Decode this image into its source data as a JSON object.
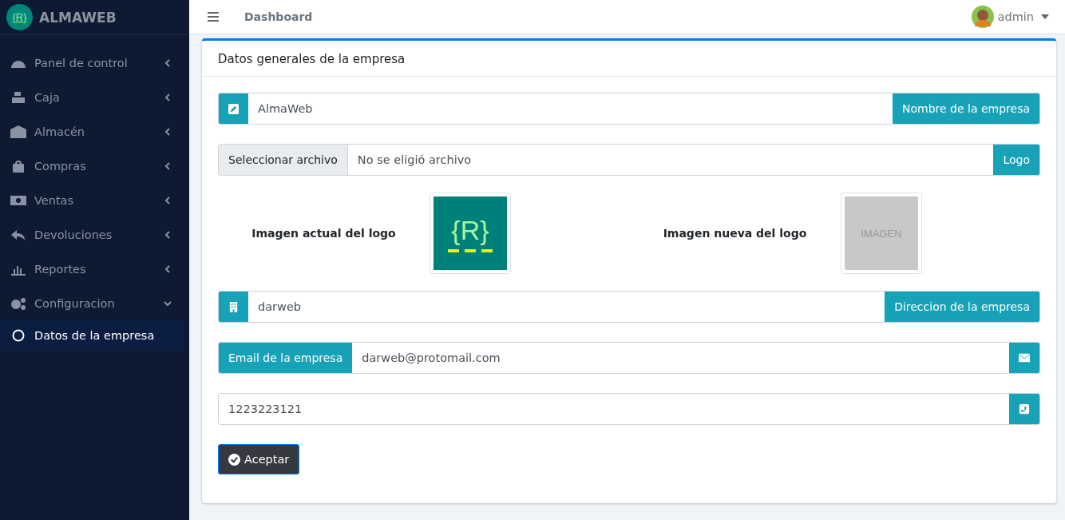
{
  "brand": {
    "logo": "{R}",
    "name": "ALMAWEB"
  },
  "sidebar": {
    "items": [
      {
        "label": "Panel de control",
        "expanded": false
      },
      {
        "label": "Caja",
        "expanded": false
      },
      {
        "label": "Almacén",
        "expanded": false
      },
      {
        "label": "Compras",
        "expanded": false
      },
      {
        "label": "Ventas",
        "expanded": false
      },
      {
        "label": "Devoluciones",
        "expanded": false
      },
      {
        "label": "Reportes",
        "expanded": false
      },
      {
        "label": "Configuracion",
        "expanded": true,
        "children": [
          {
            "label": "Datos de la empresa",
            "selected": true
          }
        ]
      }
    ]
  },
  "topbar": {
    "title": "Dashboard",
    "user": "admin"
  },
  "card": {
    "title": "Datos generales de la empresa",
    "rows": [
      {
        "kind": "name",
        "value": "AlmaWeb",
        "addon": "Nombre de la empresa"
      },
      {
        "kind": "file",
        "button": "Seleccionar archivo",
        "value": "No se eligió archivo",
        "addon": "Logo"
      },
      {
        "kind": "logos",
        "current_label": "Imagen actual del logo",
        "current_logo": "{R}",
        "new_label": "Imagen nueva del logo",
        "new_placeholder": "IMAGEN"
      },
      {
        "kind": "address",
        "value": "darweb",
        "addon": "Direccion de la empresa"
      },
      {
        "kind": "email",
        "addon": "Email de la empresa",
        "value": "darweb@protomail.com"
      },
      {
        "kind": "phone",
        "value": "1223223121"
      }
    ],
    "submit": "Aceptar"
  }
}
